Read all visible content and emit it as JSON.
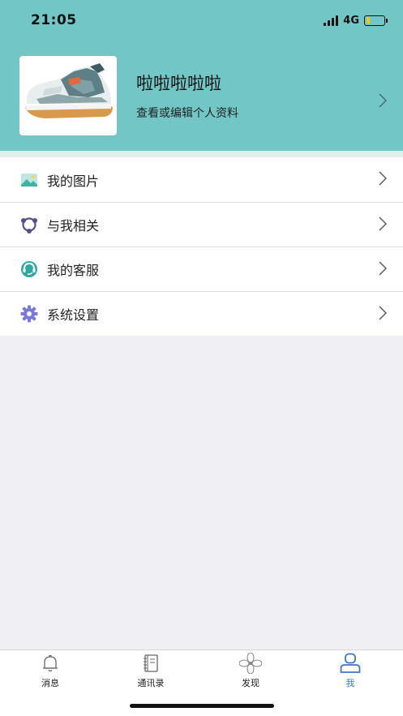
{
  "status_bar": {
    "time": "21:05",
    "network": "4G",
    "battery_color": "#f2c811"
  },
  "colors": {
    "header_bg": "#72c6c6",
    "page_bg": "#efeff4",
    "tab_active": "#3a78c4"
  },
  "profile": {
    "name": "啦啦啦啦啦",
    "subtitle": "查看或编辑个人资料",
    "avatar": "sneaker-photo"
  },
  "menu": {
    "items": [
      {
        "label": "我的图片",
        "icon": "image-icon"
      },
      {
        "label": "与我相关",
        "icon": "network-icon"
      },
      {
        "label": "我的客服",
        "icon": "customer-service-icon"
      },
      {
        "label": "系统设置",
        "icon": "gear-icon"
      }
    ]
  },
  "tabs": [
    {
      "label": "消息",
      "icon": "bell-icon",
      "active": false
    },
    {
      "label": "通讯录",
      "icon": "notebook-icon",
      "active": false
    },
    {
      "label": "发现",
      "icon": "flower-icon",
      "active": false
    },
    {
      "label": "我",
      "icon": "person-icon",
      "active": true
    }
  ]
}
